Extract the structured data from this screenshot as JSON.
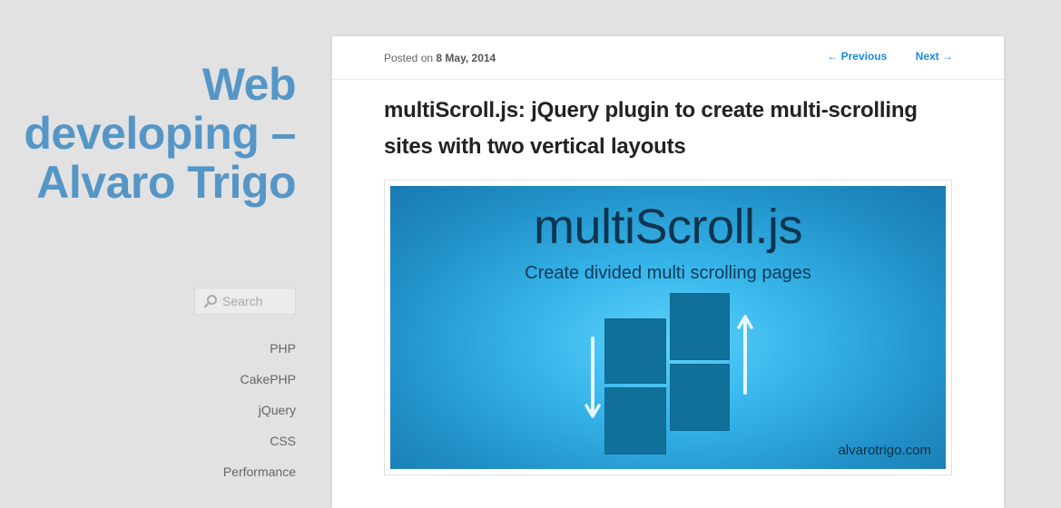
{
  "sidebar": {
    "site_title": "Web developing – Alvaro Trigo",
    "search_placeholder": "Search",
    "search_icon": "search-icon",
    "nav": [
      "PHP",
      "CakePHP",
      "jQuery",
      "CSS",
      "Performance"
    ]
  },
  "post": {
    "posted_prefix": "Posted on",
    "date": "8 May, 2014",
    "prev_label": "← Previous",
    "next_label": "Next →",
    "title": "multiScroll.js: jQuery plugin to create multi-scrolling sites with two vertical layouts",
    "image": {
      "headline": "multiScroll.js",
      "subheadline": "Create divided multi scrolling pages",
      "watermark": "alvarotrigo.com"
    }
  },
  "colors": {
    "page_bg": "#e2e2e2",
    "site_title": "#5596c7",
    "link": "#1b8be0",
    "title_text": "#222222"
  }
}
